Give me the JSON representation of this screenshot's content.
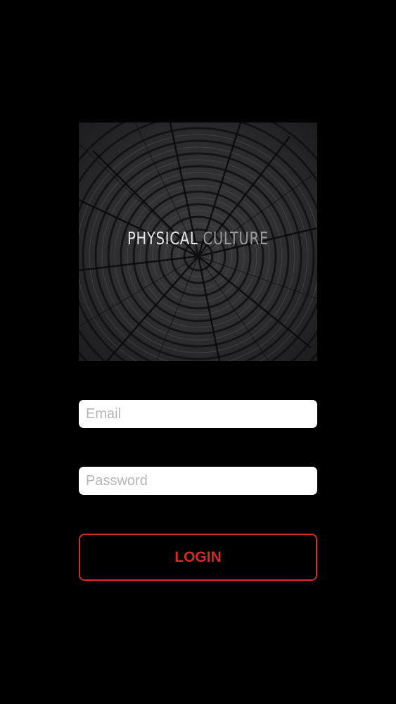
{
  "logo": {
    "word1": "PHYSICAL",
    "word2": "CULTURE"
  },
  "form": {
    "email_placeholder": "Email",
    "email_value": "",
    "password_placeholder": "Password",
    "password_value": "",
    "login_label": "LOGIN"
  },
  "colors": {
    "background": "#000000",
    "accent": "#d42a2a",
    "field_background": "#ffffff",
    "placeholder": "#b5b5ba"
  }
}
